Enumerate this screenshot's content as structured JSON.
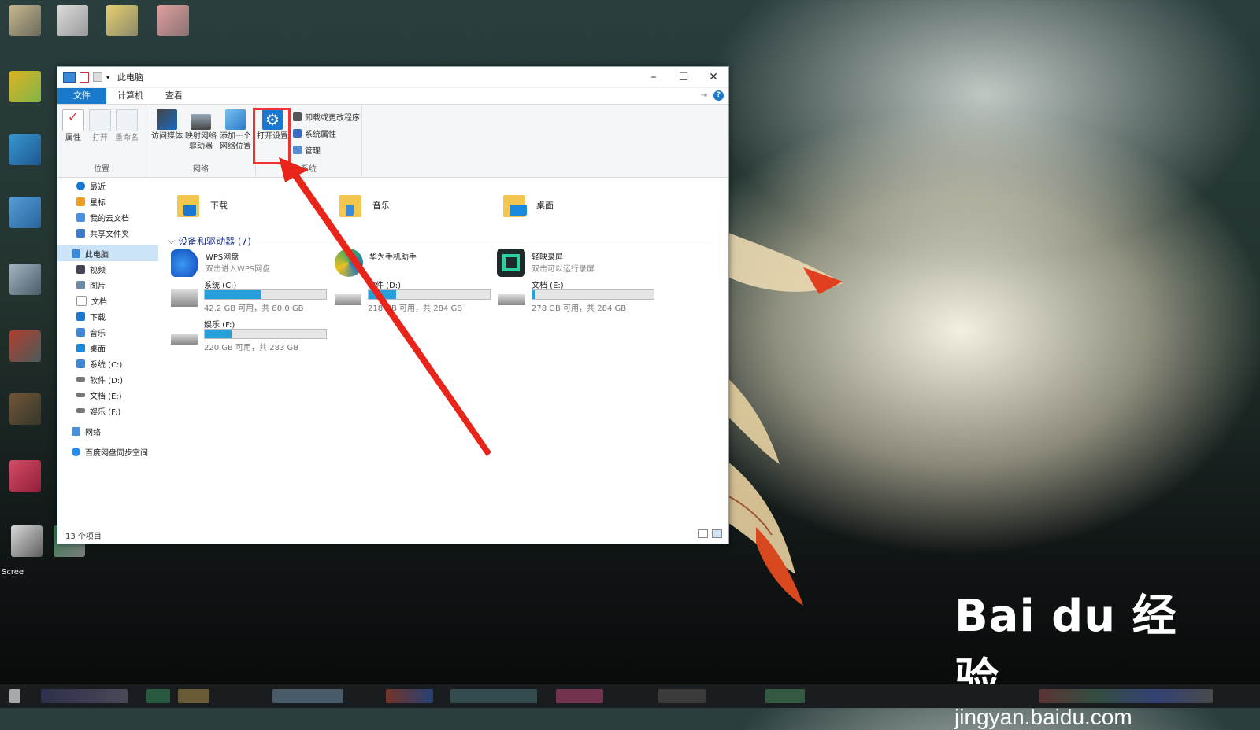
{
  "window": {
    "title": "此电脑",
    "tabs": [
      "文件",
      "计算机",
      "查看"
    ],
    "controls": [
      "–",
      "☐",
      "✕"
    ]
  },
  "ribbon": {
    "location": {
      "label": "位置",
      "buttons": [
        "属性",
        "打开",
        "重命名"
      ]
    },
    "network": {
      "label": "网络",
      "buttons": [
        "访问媒体",
        "映射网络驱动器",
        "添加一个网络位置"
      ]
    },
    "system": {
      "label": "系统",
      "open_settings": "打开设置",
      "items": [
        "卸载或更改程序",
        "系统属性",
        "管理"
      ]
    }
  },
  "nav": {
    "items": [
      "最近",
      "星标",
      "我的云文档",
      "共享文件夹",
      "此电脑",
      "视频",
      "图片",
      "文档",
      "下载",
      "音乐",
      "桌面",
      "系统 (C:)",
      "软件 (D:)",
      "文档 (E:)",
      "娱乐 (F:)",
      "网络",
      "百度网盘同步空间"
    ]
  },
  "folders": [
    "下载",
    "音乐",
    "桌面"
  ],
  "section_title": "设备和驱动器 (7)",
  "apps": [
    {
      "name": "WPS网盘",
      "sub": "双击进入WPS网盘"
    },
    {
      "name": "华为手机助手",
      "sub": ""
    },
    {
      "name": "轻映录屏",
      "sub": "双击可以运行录屏"
    }
  ],
  "drives": [
    {
      "name": "系统 (C:)",
      "free": "42.2 GB 可用，共 80.0 GB",
      "used_fraction": 0.47
    },
    {
      "name": "软件 (D:)",
      "free": "218 GB 可用，共 284 GB",
      "used_fraction": 0.23
    },
    {
      "name": "文档 (E:)",
      "free": "278 GB 可用，共 284 GB",
      "used_fraction": 0.02
    },
    {
      "name": "娱乐 (F:)",
      "free": "220 GB 可用，共 283 GB",
      "used_fraction": 0.22
    }
  ],
  "status": {
    "count": "13 个项目"
  },
  "watermark": {
    "logo": "Bai du 经验",
    "url": "jingyan.baidu.com"
  },
  "desktop": {
    "label": "Scree"
  },
  "colors": {
    "accent": "#1979ca",
    "drive_bar": "#26a0da",
    "highlight": "#e33333",
    "arrow": "#e8241b"
  }
}
